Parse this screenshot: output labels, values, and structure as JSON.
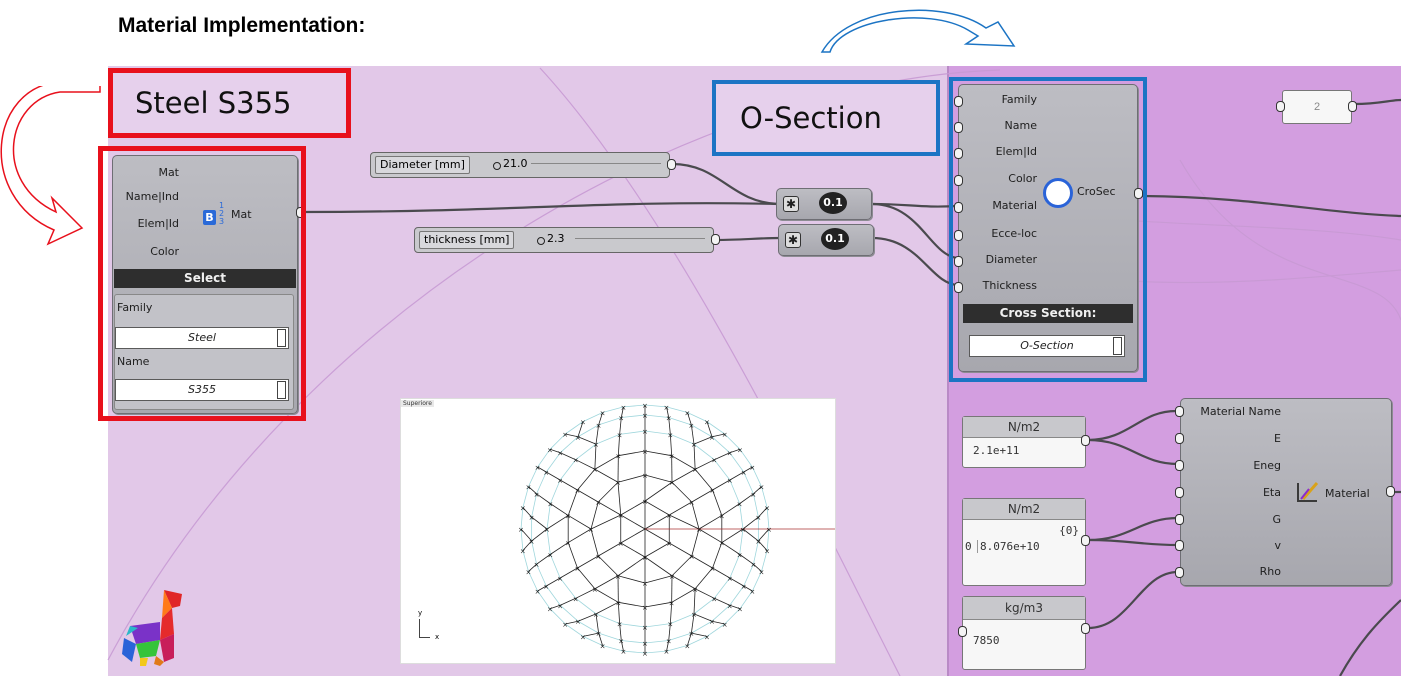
{
  "heading": "Material Implementation:",
  "callouts": {
    "material": "Steel S355",
    "section": "O-Section"
  },
  "material_selector": {
    "inputs": [
      "Mat",
      "Name|Ind",
      "Elem|Id",
      "Color"
    ],
    "output": "Mat",
    "list_marks": [
      "1",
      "2",
      "3"
    ],
    "icon_letter": "B",
    "select_label": "Select",
    "family_label": "Family",
    "family_value": "Steel",
    "name_label": "Name",
    "name_value": "S355"
  },
  "sliders": {
    "diameter": {
      "name": "Diameter [mm]",
      "value": "21.0"
    },
    "thickness": {
      "name": "thickness [mm]",
      "value": "2.3"
    }
  },
  "multipliers": [
    {
      "factor": "0.1"
    },
    {
      "factor": "0.1"
    }
  ],
  "cross_section": {
    "inputs": [
      "Family",
      "Name",
      "Elem|Id",
      "Color",
      "Material",
      "Ecce-loc",
      "Diameter",
      "Thickness"
    ],
    "output": "CroSec",
    "bar_label": "Cross Section:",
    "value": "O-Section"
  },
  "number_panel": {
    "value": "2"
  },
  "panels": [
    {
      "header": "N/m2",
      "lines": [
        "2.1e+11"
      ]
    },
    {
      "header": "N/m2",
      "path": "{0}",
      "index": "0",
      "lines": [
        "8.076e+10"
      ]
    },
    {
      "header": "kg/m3",
      "lines": [
        "7850"
      ]
    }
  ],
  "material_component": {
    "inputs": [
      "Material Name",
      "E",
      "Eneg",
      "Eta",
      "G",
      "v",
      "Rho"
    ],
    "output": "Material"
  },
  "viewport": {
    "label": "Superiore",
    "axis_x": "x",
    "axis_y": "y"
  },
  "colors": {
    "canvas": "#e2c8e8",
    "canvas_right": "#d39ee0",
    "highlight_red": "#e8101c",
    "highlight_blue": "#1c74c4"
  }
}
